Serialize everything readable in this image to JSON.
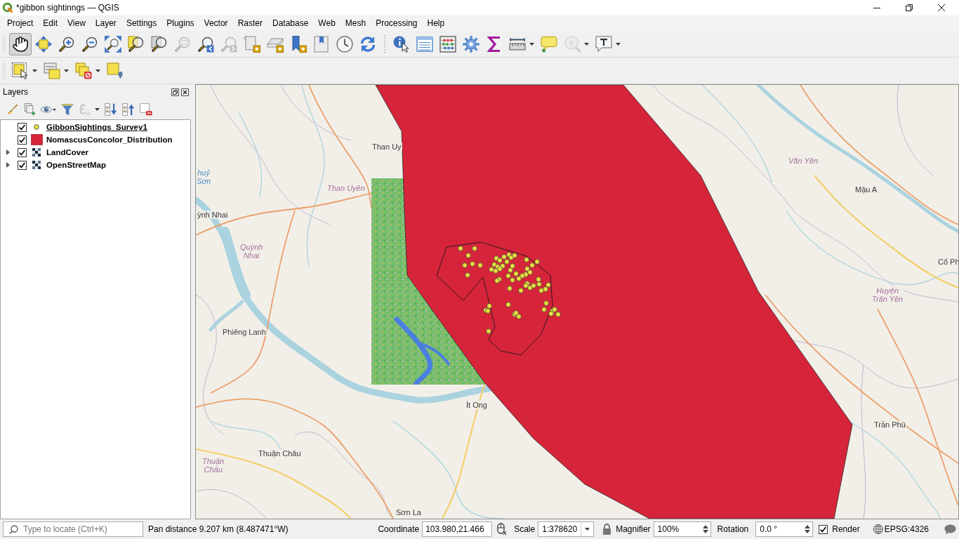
{
  "window": {
    "title": "*gibbon sightinngs — QGIS"
  },
  "menu": [
    "Project",
    "Edit",
    "View",
    "Layer",
    "Settings",
    "Plugins",
    "Vector",
    "Raster",
    "Database",
    "Web",
    "Mesh",
    "Processing",
    "Help"
  ],
  "toolbars": [
    {
      "groups": [
        {
          "buttons": [
            {
              "kind": "pan",
              "pressed": true,
              "disabled": false,
              "menu": false
            },
            {
              "kind": "pan_to_selection",
              "pressed": false,
              "disabled": false,
              "menu": false
            },
            {
              "kind": "zoom_in",
              "pressed": false,
              "disabled": false,
              "menu": false
            },
            {
              "kind": "zoom_out",
              "pressed": false,
              "disabled": false,
              "menu": false
            },
            {
              "kind": "zoom_full",
              "pressed": false,
              "disabled": false,
              "menu": false
            },
            {
              "kind": "zoom_to_selection",
              "pressed": false,
              "disabled": false,
              "menu": false
            },
            {
              "kind": "zoom_to_layer",
              "pressed": false,
              "disabled": false,
              "menu": false
            },
            {
              "kind": "zoom_native",
              "pressed": false,
              "disabled": true,
              "menu": false
            },
            {
              "kind": "zoom_last",
              "pressed": false,
              "disabled": false,
              "menu": false
            },
            {
              "kind": "zoom_next",
              "pressed": false,
              "disabled": true,
              "menu": false
            },
            {
              "kind": "new_map_view",
              "pressed": false,
              "disabled": false,
              "menu": false
            },
            {
              "kind": "new_3d_map_view",
              "pressed": false,
              "disabled": false,
              "menu": false
            },
            {
              "kind": "new_bookmark",
              "pressed": false,
              "disabled": false,
              "menu": false
            },
            {
              "kind": "show_bookmarks",
              "pressed": false,
              "disabled": false,
              "menu": false
            },
            {
              "kind": "temporal_controller",
              "pressed": false,
              "disabled": false,
              "menu": false
            },
            {
              "kind": "refresh",
              "pressed": false,
              "disabled": false,
              "menu": false
            }
          ]
        },
        {
          "buttons": [
            {
              "kind": "identify",
              "pressed": false,
              "disabled": false,
              "menu": false
            },
            {
              "kind": "attribute_table",
              "pressed": false,
              "disabled": false,
              "menu": false
            },
            {
              "kind": "field_calculator",
              "pressed": false,
              "disabled": false,
              "menu": false
            },
            {
              "kind": "processing_toolbox",
              "pressed": false,
              "disabled": false,
              "menu": false
            },
            {
              "kind": "statistical_summary",
              "pressed": false,
              "disabled": false,
              "menu": false
            },
            {
              "kind": "measure",
              "pressed": false,
              "disabled": false,
              "menu": true
            },
            {
              "kind": "map_tips",
              "pressed": false,
              "disabled": false,
              "menu": false
            },
            {
              "kind": "search_gear",
              "pressed": false,
              "disabled": true,
              "menu": true
            },
            {
              "kind": "text_annotation",
              "pressed": false,
              "disabled": false,
              "menu": true
            }
          ]
        }
      ]
    },
    {
      "groups": [
        {
          "buttons": [
            {
              "kind": "select_features",
              "pressed": false,
              "disabled": false,
              "menu": true
            },
            {
              "kind": "select_by_value",
              "pressed": false,
              "disabled": false,
              "menu": true
            },
            {
              "kind": "deselect",
              "pressed": false,
              "disabled": false,
              "menu": true
            },
            {
              "kind": "select_by_location",
              "pressed": false,
              "disabled": false,
              "menu": false
            }
          ]
        }
      ]
    }
  ],
  "layers_panel": {
    "title": "Layers",
    "tools": [
      {
        "kind": "style",
        "disabled": false,
        "menu": false
      },
      {
        "kind": "add_group",
        "disabled": false,
        "menu": false
      },
      {
        "kind": "visibility",
        "disabled": false,
        "menu": true
      },
      {
        "kind": "filter",
        "disabled": false,
        "menu": false
      },
      {
        "kind": "expression",
        "disabled": true,
        "menu": true
      },
      {
        "kind": "expand_all",
        "disabled": false,
        "menu": false
      },
      {
        "kind": "collapse_all",
        "disabled": false,
        "menu": false
      },
      {
        "kind": "remove",
        "disabled": false,
        "menu": false
      }
    ],
    "layers": [
      {
        "name": "GibbonSightings_Survey1",
        "kind": "point",
        "color": "#eadf3f",
        "checked": true,
        "underlined": true,
        "expandable": false,
        "expanded": false
      },
      {
        "name": "NomascusConcolor_Distribution",
        "kind": "polygon",
        "color": "#d6243a",
        "checked": true,
        "underlined": false,
        "expandable": false,
        "expanded": false
      },
      {
        "name": "LandCover",
        "kind": "raster",
        "checked": true,
        "underlined": false,
        "expandable": true,
        "expanded": false
      },
      {
        "name": "OpenStreetMap",
        "kind": "tiles",
        "checked": true,
        "underlined": false,
        "expandable": true,
        "expanded": false
      }
    ]
  },
  "map": {
    "labels": [
      {
        "lines": [
          "Than Uy"
        ],
        "kind": "place"
      },
      {
        "lines": [
          "Văn Yên"
        ],
        "kind": "district"
      },
      {
        "lines": [
          "huỷ",
          "Sơn"
        ],
        "kind": "water"
      },
      {
        "lines": [
          "Than Uyên"
        ],
        "kind": "district"
      },
      {
        "lines": [
          "Mậu A"
        ],
        "kind": "place"
      },
      {
        "lines": [
          "ỳnh Nhai"
        ],
        "kind": "place"
      },
      {
        "lines": [
          "Quỳnh",
          "Nhai"
        ],
        "kind": "district"
      },
      {
        "lines": [
          "Cổ Ph"
        ],
        "kind": "place"
      },
      {
        "lines": [
          "Huyện",
          "Trấn Yên"
        ],
        "kind": "district"
      },
      {
        "lines": [
          "Phiêng Lanh"
        ],
        "kind": "place"
      },
      {
        "lines": [
          "Ít Ong"
        ],
        "kind": "place"
      },
      {
        "lines": [
          "Trần Phú"
        ],
        "kind": "place"
      },
      {
        "lines": [
          "Thuận Châu"
        ],
        "kind": "place"
      },
      {
        "lines": [
          "Thuận",
          "Châu"
        ],
        "kind": "district"
      },
      {
        "lines": [
          "Sơn La"
        ],
        "kind": "place"
      }
    ]
  },
  "status_bar": {
    "locator": {
      "placeholder": "Type to locate (Ctrl+K)"
    },
    "message": "Pan distance 9.207 km (8.487471°W)",
    "coordinate": {
      "label": "Coordinate",
      "value": "103.980,21.466"
    },
    "scale": {
      "label": "Scale",
      "value": "1:378620"
    },
    "magnifier": {
      "label": "Magnifier",
      "value": "100%"
    },
    "rotation": {
      "label": "Rotation",
      "value": "0.0 °"
    },
    "render": {
      "label": "Render",
      "checked": true
    },
    "crs": "EPSG:4326"
  }
}
